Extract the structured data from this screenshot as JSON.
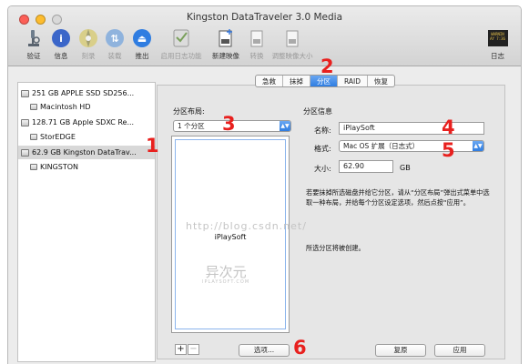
{
  "window": {
    "title": "Kingston DataTraveler 3.0 Media"
  },
  "toolbar": {
    "verify": "验证",
    "info": "信息",
    "burn": "刻录",
    "mount": "装载",
    "eject": "推出",
    "enable_journal": "启用日志功能",
    "new_image": "新建映像",
    "convert": "转换",
    "resize_image": "调整映像大小",
    "log": "日志",
    "log_icon_text": "WARNIN\nAY 7:36"
  },
  "sidebar": {
    "items": [
      {
        "label": "251 GB APPLE SSD SD256..."
      },
      {
        "label": "Macintosh HD"
      },
      {
        "label": "128.71 GB Apple SDXC Re..."
      },
      {
        "label": "StorEDGE"
      },
      {
        "label": "62.9 GB Kingston DataTrav..."
      },
      {
        "label": "KINGSTON"
      }
    ]
  },
  "tabs": [
    {
      "label": "急救"
    },
    {
      "label": "抹掉"
    },
    {
      "label": "分区"
    },
    {
      "label": "RAID"
    },
    {
      "label": "恢复"
    }
  ],
  "partition": {
    "layout_label": "分区布局:",
    "layout_value": "1 个分区",
    "info_label": "分区信息",
    "name_label": "名称:",
    "name_value": "iPlaySoft",
    "format_label": "格式:",
    "format_value": "Mac OS 扩展（日志式）",
    "size_label": "大小:",
    "size_value": "62.90",
    "size_unit": "GB",
    "map_partition_name": "iPlaySoft",
    "description": "若要抹掉所选磁盘并给它分区，请从“分区布局”弹出式菜单中选取一种布局，并给每个分区设定选项，然后点按“应用”。",
    "status": "所选分区将被创建。",
    "options_button": "选项...",
    "revert_button": "复原",
    "apply_button": "应用",
    "add_button": "+",
    "remove_button": "−"
  },
  "annotations": [
    "1",
    "2",
    "3",
    "4",
    "5",
    "6"
  ],
  "watermark": {
    "url": "http://blog.csdn.net/",
    "logo_main": "异次元",
    "logo_sub": "IPLAYSOFT.COM"
  },
  "colors": {
    "accent": "#2f7de1",
    "annotation": "#e8201e",
    "selection": "#d8d8d8"
  }
}
